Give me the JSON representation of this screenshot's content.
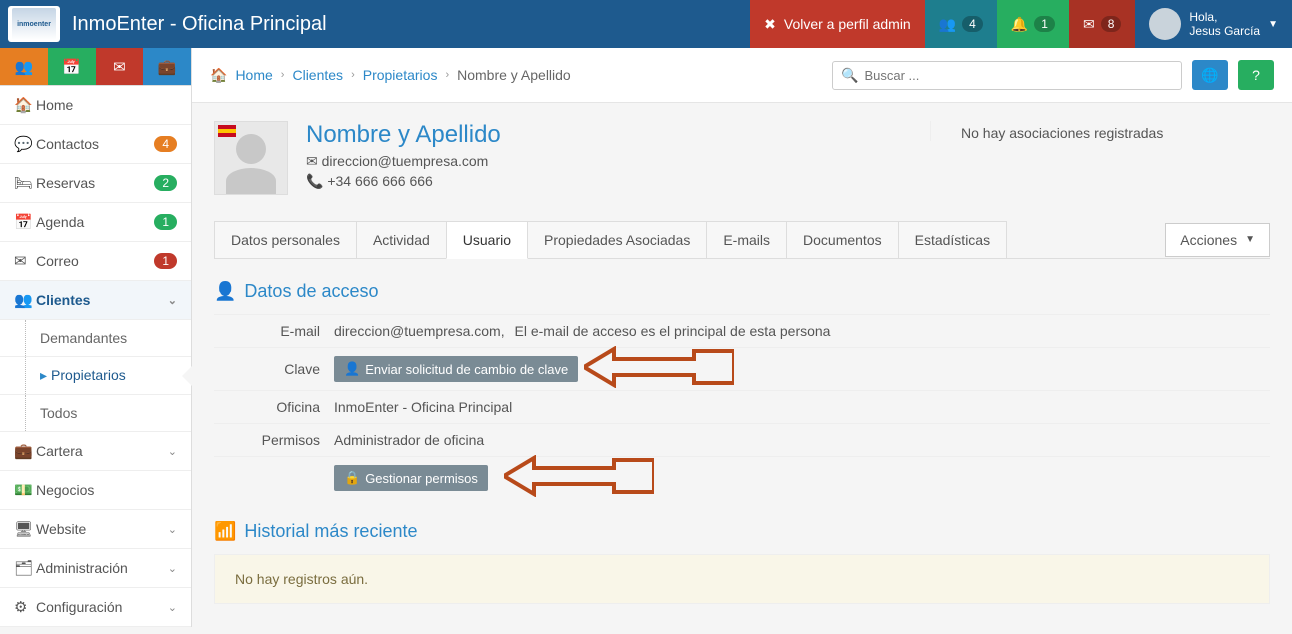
{
  "app": {
    "title": "InmoEnter - Oficina Principal"
  },
  "topbar": {
    "back_admin": "Volver a perfil admin",
    "users_badge": "4",
    "bell_badge": "1",
    "mail_badge": "8",
    "hello": "Hola,",
    "username": "Jesus García"
  },
  "breadcrumb": {
    "home": "Home",
    "clients": "Clientes",
    "owners": "Propietarios",
    "current": "Nombre y Apellido"
  },
  "search": {
    "placeholder": "Buscar ..."
  },
  "sidebar": {
    "home": "Home",
    "contactos": "Contactos",
    "contactos_badge": "4",
    "reservas": "Reservas",
    "reservas_badge": "2",
    "agenda": "Agenda",
    "agenda_badge": "1",
    "correo": "Correo",
    "correo_badge": "1",
    "clientes": "Clientes",
    "demandantes": "Demandantes",
    "propietarios": "Propietarios",
    "todos": "Todos",
    "cartera": "Cartera",
    "negocios": "Negocios",
    "website": "Website",
    "administracion": "Administración",
    "configuracion": "Configuración"
  },
  "profile": {
    "name": "Nombre y Apellido",
    "email": "direccion@tuempresa.com",
    "phone": "+34 666 666 666",
    "assoc": "No hay asociaciones registradas"
  },
  "tabs": {
    "datos": "Datos personales",
    "actividad": "Actividad",
    "usuario": "Usuario",
    "propiedades": "Propiedades Asociadas",
    "emails": "E-mails",
    "documentos": "Documentos",
    "estadisticas": "Estadísticas",
    "acciones": "Acciones"
  },
  "access": {
    "heading": "Datos de acceso",
    "email_label": "E-mail",
    "email_val": "direccion@tuempresa.com,",
    "email_note": "El e-mail de acceso es el principal de esta persona",
    "clave_label": "Clave",
    "clave_btn": "Enviar solicitud de cambio de clave",
    "oficina_label": "Oficina",
    "oficina_val": "InmoEnter - Oficina Principal",
    "permisos_label": "Permisos",
    "permisos_val": "Administrador de oficina",
    "gestionar_btn": "Gestionar permisos"
  },
  "history": {
    "heading": "Historial más reciente",
    "empty": "No hay registros aún."
  }
}
